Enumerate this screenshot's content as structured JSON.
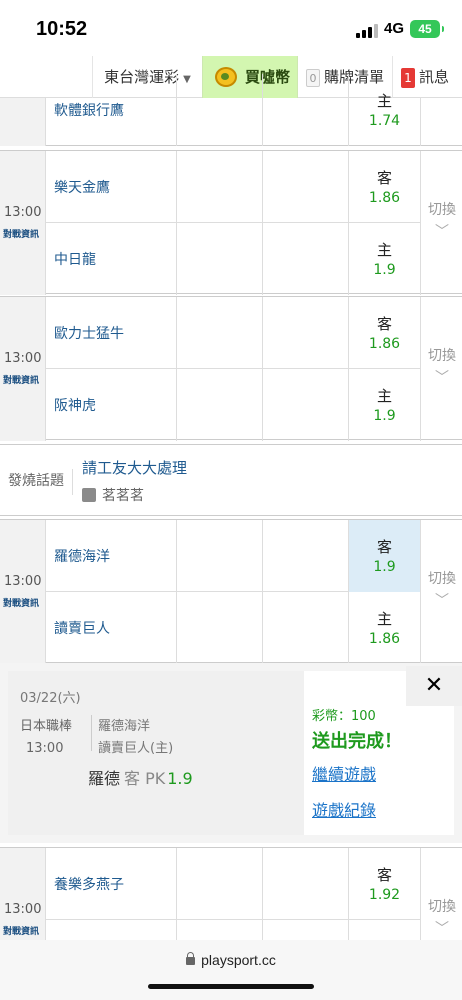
{
  "status_bar": {
    "time": "10:52",
    "network": "4G",
    "battery": "45"
  },
  "nav": {
    "region": "東台灣運彩",
    "buy": "買噓幣",
    "list_label": "購牌清單",
    "list_count": "0",
    "msg_label": "訊息",
    "msg_count": "1"
  },
  "games": [
    {
      "time": "",
      "info": "",
      "away": "",
      "home": "軟體銀行鷹",
      "away_side": "",
      "away_odds": "",
      "home_side": "主",
      "home_odds": "1.74",
      "switch": ""
    },
    {
      "time": "13:00",
      "info": "對戰資訊",
      "away": "樂天金鷹",
      "home": "中日龍",
      "away_side": "客",
      "away_odds": "1.86",
      "home_side": "主",
      "home_odds": "1.9",
      "switch": "切換"
    },
    {
      "time": "13:00",
      "info": "對戰資訊",
      "away": "歐力士猛牛",
      "home": "阪神虎",
      "away_side": "客",
      "away_odds": "1.86",
      "home_side": "主",
      "home_odds": "1.9",
      "switch": "切換"
    },
    {
      "time": "13:00",
      "info": "對戰資訊",
      "away": "羅德海洋",
      "home": "讀賣巨人",
      "away_side": "客",
      "away_odds": "1.9",
      "home_side": "主",
      "home_odds": "1.86",
      "switch": "切換"
    },
    {
      "time": "13:00",
      "info": "對戰資訊",
      "away": "養樂多燕子",
      "home": "",
      "away_side": "客",
      "away_odds": "1.92",
      "home_side": "",
      "home_odds": "",
      "switch": "切換"
    }
  ],
  "hot_topic": {
    "label": "發燒話題",
    "title": "請工友大大處理",
    "user": "茗茗茗"
  },
  "bet": {
    "date": "03/22(六)",
    "league": "日本職棒",
    "time": "13:00",
    "team1": "羅德海洋",
    "team2": "讀賣巨人(主)",
    "pick_team": "羅德",
    "pick_side": "客 PK",
    "pick_odds": "1.9",
    "coins": "彩幣：100",
    "status": "送出完成！",
    "continue_link": "繼續遊戲",
    "history_link": "遊戲紀錄"
  },
  "url_bar": {
    "url": "playsport.cc"
  }
}
